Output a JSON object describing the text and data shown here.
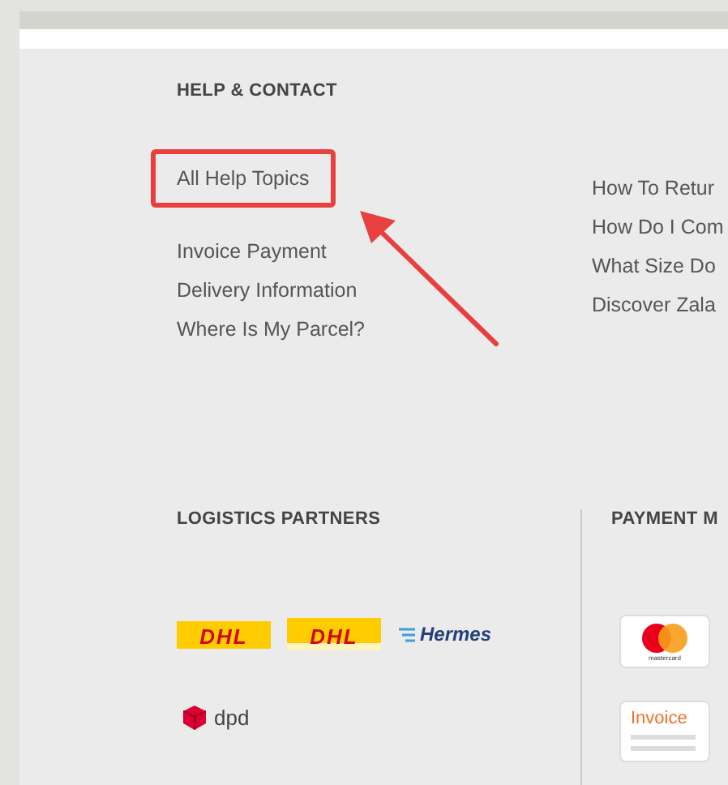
{
  "help": {
    "title": "HELP & CONTACT",
    "links": [
      {
        "label": "All Help Topics",
        "highlighted": true
      },
      {
        "label": "Invoice Payment",
        "highlighted": false
      },
      {
        "label": "Delivery Information",
        "highlighted": false
      },
      {
        "label": "Where Is My Parcel?",
        "highlighted": false
      }
    ],
    "more_links": [
      "How To Retur",
      "How Do I Com",
      "What Size Do",
      "Discover Zala"
    ]
  },
  "logistics": {
    "title": "LOGISTICS PARTNERS",
    "partners": [
      {
        "kind": "dhl",
        "name": "DHL"
      },
      {
        "kind": "dhl-express",
        "name": "DHL"
      },
      {
        "kind": "hermes",
        "name": "Hermes"
      },
      {
        "kind": "dpd",
        "name": "dpd"
      }
    ]
  },
  "payment": {
    "title": "PAYMENT M",
    "methods": [
      {
        "kind": "mastercard",
        "name": "mastercard"
      },
      {
        "kind": "invoice",
        "name": "Invoice"
      }
    ]
  }
}
